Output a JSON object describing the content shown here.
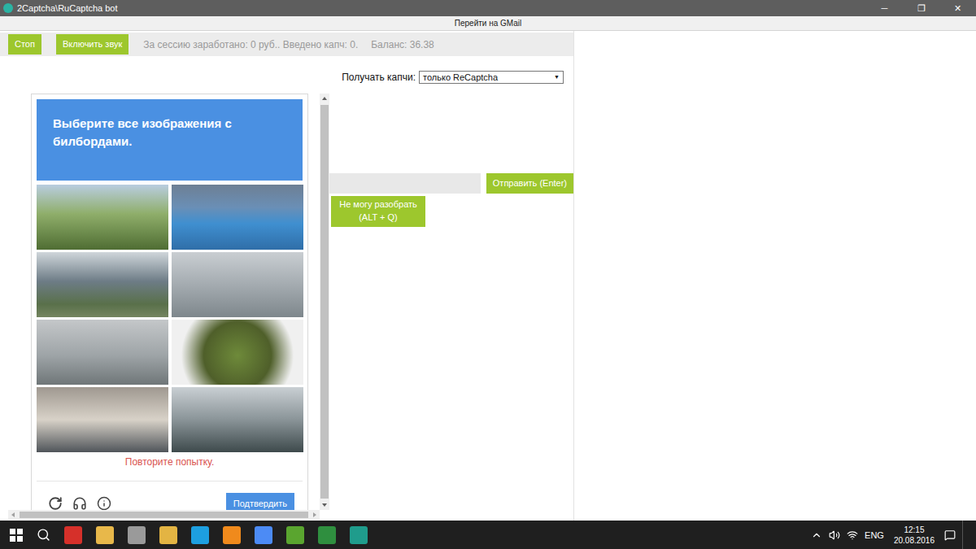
{
  "window": {
    "title": "2Captcha\\RuCaptcha bot",
    "controls": [
      "─",
      "❐",
      "✕"
    ]
  },
  "gmail_link": "Перейти на GMail",
  "toolbar": {
    "buttons": [
      "Стоп",
      "Включить звук"
    ],
    "stats": "За сессию заработано: 0 руб.. Введено капч: 0.",
    "balance": "Баланс: 36.38"
  },
  "captcha_filter": {
    "label": "Получать капчи:",
    "value": "только ReCaptcha",
    "arrow": "▼"
  },
  "captcha": {
    "instruction": "Выберите все изображения с",
    "keyword": "билбордами.",
    "tiles": [
      {
        "selected": false
      },
      {
        "selected": false
      },
      {
        "selected": false
      },
      {
        "selected": false
      },
      {
        "selected": false
      },
      {
        "selected": false
      },
      {
        "selected": false
      },
      {
        "selected": false
      }
    ],
    "error": "Повторите попытку.",
    "verify": "Подтвердить"
  },
  "answer": {
    "value": "",
    "send": "Отправить (Enter)",
    "skip": "Не могу разобрать (ALT + Q)"
  },
  "taskbar": {
    "language": "ENG",
    "time": "12:15",
    "date": "20.08.2016"
  }
}
